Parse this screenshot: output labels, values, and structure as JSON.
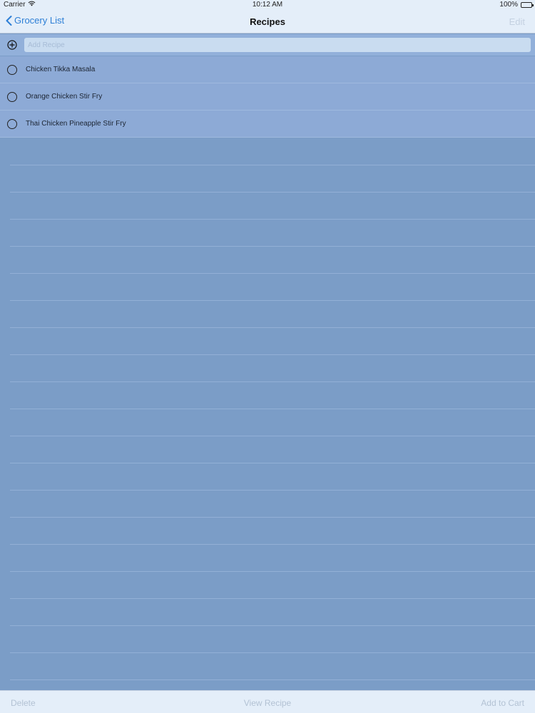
{
  "status_bar": {
    "carrier": "Carrier",
    "time": "10:12 AM",
    "battery": "100%",
    "battery_level": 1.0
  },
  "nav": {
    "back_label": "Grocery List",
    "title": "Recipes",
    "edit_label": "Edit"
  },
  "add_recipe": {
    "placeholder": "Add Recipe",
    "value": ""
  },
  "recipes": [
    {
      "label": "Chicken Tikka Masala",
      "selected": false
    },
    {
      "label": "Orange Chicken Stir Fry",
      "selected": false
    },
    {
      "label": "Thai Chicken Pineapple Stir Fry",
      "selected": false
    }
  ],
  "toolbar": {
    "delete_label": "Delete",
    "view_label": "View Recipe",
    "cart_label": "Add to Cart"
  },
  "colors": {
    "accent": "#2d7fd6",
    "background": "#7b9dc7",
    "row_background": "#8daad6",
    "bar_background": "#e4eef9",
    "disabled_text": "#b3c2d4"
  }
}
